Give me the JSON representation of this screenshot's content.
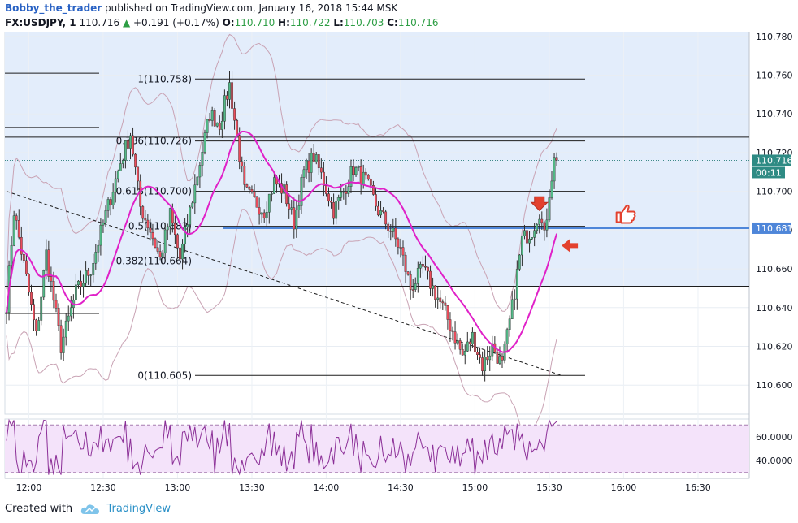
{
  "header": {
    "author": "Bobby_the_trader",
    "published": " published on TradingView.com, January 16, 2018 15:44 MSK",
    "symbol": "FX:USDJPY, 1",
    "last": "110.716",
    "change": "+0.191 (+0.17%)",
    "o_label": "O:",
    "o_val": "110.710",
    "h_label": "H:",
    "h_val": "110.722",
    "l_label": "L:",
    "l_val": "110.703",
    "c_label": "C:",
    "c_val": "110.716"
  },
  "footer": {
    "created": "Created with",
    "brand": "TradingView"
  },
  "colors": {
    "up": "#53b987",
    "down": "#eb4d5c",
    "sma": "#e021c8",
    "band": "#c9a3b4",
    "fib_fill": "#e3edfb",
    "rsi_fill": "#f4e3fa",
    "rsi_line": "#8b2f97",
    "hline": "#4e86d9",
    "arrow": "#e3412e"
  },
  "chart_data": {
    "type": "candlestick",
    "symbol": "FX:USDJPY",
    "interval": "1",
    "ylim": [
      110.585,
      110.782
    ],
    "y_ticks": [
      "110.780",
      "110.760",
      "110.740",
      "110.720",
      "110.700",
      "110.680",
      "110.660",
      "110.640",
      "110.620",
      "110.600"
    ],
    "x_ticks": [
      "12:00",
      "12:30",
      "13:00",
      "13:30",
      "14:00",
      "14:30",
      "15:00",
      "15:30",
      "16:00",
      "16:30"
    ],
    "time_range": [
      "11:51",
      "15:45"
    ],
    "last_price_label": "110.716",
    "countdown_label": "00:11",
    "horizontal_line_label": "110.681",
    "horizontal_line": 110.681,
    "fib_levels": [
      {
        "label": "1(110.758)",
        "value": 110.758
      },
      {
        "label": "0.786(110.726)",
        "value": 110.726
      },
      {
        "label": "0.618(110.700)",
        "value": 110.7
      },
      {
        "label": "0.5(110.682)",
        "value": 110.682
      },
      {
        "label": "0.382(110.664)",
        "value": 110.664
      },
      {
        "label": "0(110.605)",
        "value": 110.605
      }
    ],
    "close_path": [
      [
        0,
        110.642
      ],
      [
        3,
        110.69
      ],
      [
        8,
        110.655
      ],
      [
        12,
        110.625
      ],
      [
        16,
        110.668
      ],
      [
        22,
        110.62
      ],
      [
        28,
        110.648
      ],
      [
        34,
        110.66
      ],
      [
        40,
        110.688
      ],
      [
        46,
        110.715
      ],
      [
        50,
        110.73
      ],
      [
        54,
        110.692
      ],
      [
        58,
        110.68
      ],
      [
        62,
        110.665
      ],
      [
        66,
        110.688
      ],
      [
        70,
        110.665
      ],
      [
        74,
        110.69
      ],
      [
        78,
        110.715
      ],
      [
        82,
        110.74
      ],
      [
        86,
        110.735
      ],
      [
        90,
        110.755
      ],
      [
        93,
        110.728
      ],
      [
        96,
        110.7
      ],
      [
        100,
        110.695
      ],
      [
        104,
        110.69
      ],
      [
        108,
        110.705
      ],
      [
        112,
        110.7
      ],
      [
        116,
        110.684
      ],
      [
        120,
        110.71
      ],
      [
        124,
        110.718
      ],
      [
        128,
        110.705
      ],
      [
        132,
        110.69
      ],
      [
        136,
        110.7
      ],
      [
        140,
        110.712
      ],
      [
        145,
        110.705
      ],
      [
        150,
        110.69
      ],
      [
        155,
        110.68
      ],
      [
        159,
        110.67
      ],
      [
        163,
        110.65
      ],
      [
        168,
        110.66
      ],
      [
        172,
        110.65
      ],
      [
        176,
        110.64
      ],
      [
        180,
        110.628
      ],
      [
        184,
        110.615
      ],
      [
        188,
        110.625
      ],
      [
        192,
        110.61
      ],
      [
        196,
        110.62
      ],
      [
        200,
        110.61
      ],
      [
        204,
        110.64
      ],
      [
        208,
        110.675
      ],
      [
        212,
        110.68
      ],
      [
        215,
        110.69
      ],
      [
        217,
        110.676
      ],
      [
        219,
        110.7
      ],
      [
        221,
        110.716
      ],
      [
        222,
        110.716
      ]
    ],
    "rsi": {
      "levels": [
        70,
        30
      ],
      "y_ticks": [
        "60.0000",
        "40.0000"
      ],
      "ylim": [
        25,
        75
      ],
      "last": 73
    },
    "annotations": {
      "trendline": [
        [
          0,
          110.7
        ],
        [
          224,
          110.605
        ]
      ],
      "down_arrow_at": [
        215,
        110.688
      ],
      "left_arrow_at": [
        222,
        110.672
      ],
      "thumbs_up_at": [
        233,
        110.69
      ]
    }
  }
}
